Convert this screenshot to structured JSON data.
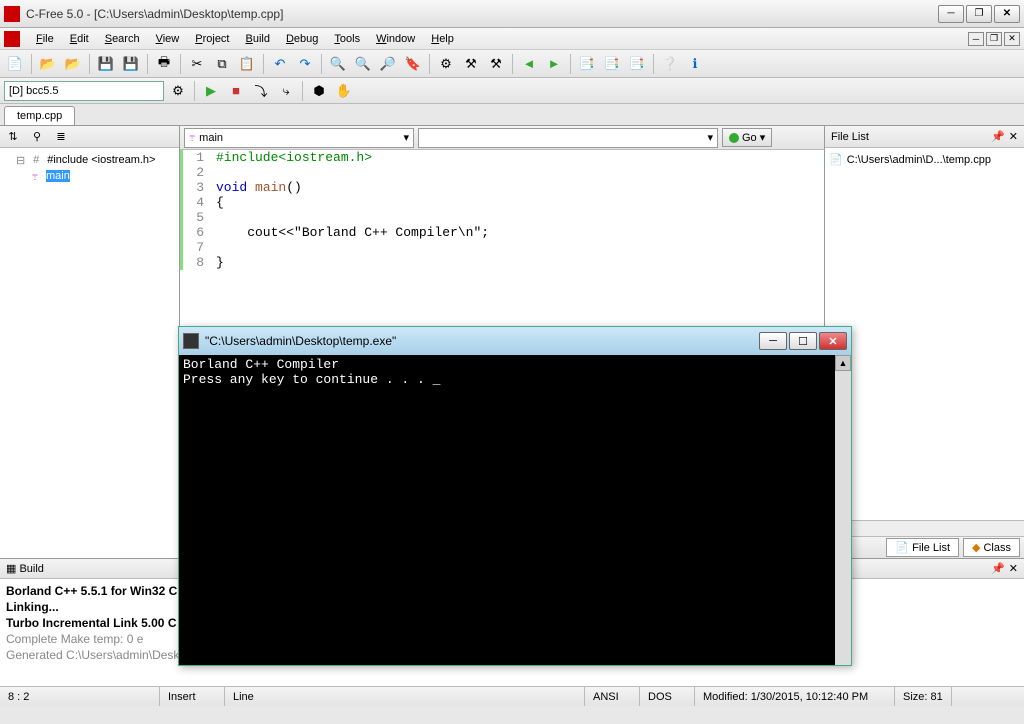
{
  "app": {
    "title": "C-Free 5.0 - [C:\\Users\\admin\\Desktop\\temp.cpp]"
  },
  "menu": [
    "File",
    "Edit",
    "Search",
    "View",
    "Project",
    "Build",
    "Debug",
    "Tools",
    "Window",
    "Help"
  ],
  "compiler": "[D] bcc5.5",
  "tabs": [
    "temp.cpp"
  ],
  "tree": {
    "include": "#include <iostream.h>",
    "main": "main"
  },
  "funcCombo": "main",
  "goLabel": "Go",
  "code": [
    {
      "n": "1",
      "pre": "#include",
      "rest": "<iostream.h>"
    },
    {
      "n": "2",
      "pre": "",
      "rest": ""
    },
    {
      "n": "3",
      "kw": "void",
      "fn": "main",
      "rest": "()"
    },
    {
      "n": "4",
      "rest": "{"
    },
    {
      "n": "5",
      "rest": ""
    },
    {
      "n": "6",
      "rest": "    cout<<\"Borland C++ Compiler\\n\";"
    },
    {
      "n": "7",
      "rest": ""
    },
    {
      "n": "8",
      "rest": "}"
    }
  ],
  "rightPanel": {
    "title": "File List",
    "item": "C:\\Users\\admin\\D...\\temp.cpp"
  },
  "bottomTabs": {
    "fileList": "File List",
    "class": "Class"
  },
  "build": {
    "title": "Build",
    "lines": [
      {
        "t": "Borland C++ 5.5.1 for Win32 C",
        "bold": true
      },
      {
        "t": "Linking...",
        "bold": true
      },
      {
        "t": "Turbo Incremental Link 5.00 C",
        "bold": true
      },
      {
        "t": " ",
        "bold": false
      },
      {
        "t": "Complete Make temp: 0 e",
        "gray": true
      },
      {
        "t": "Generated C:\\Users\\admin\\Desktop\\temp.exe",
        "gray": true
      }
    ]
  },
  "status": {
    "pos": "8 : 2",
    "insert": "Insert",
    "line": "Line",
    "enc": "ANSI",
    "eol": "DOS",
    "modified": "Modified: 1/30/2015, 10:12:40 PM",
    "size": "Size: 81"
  },
  "console": {
    "title": "\"C:\\Users\\admin\\Desktop\\temp.exe\"",
    "line1": "Borland C++ Compiler",
    "line2": "Press any key to continue . . . _"
  }
}
